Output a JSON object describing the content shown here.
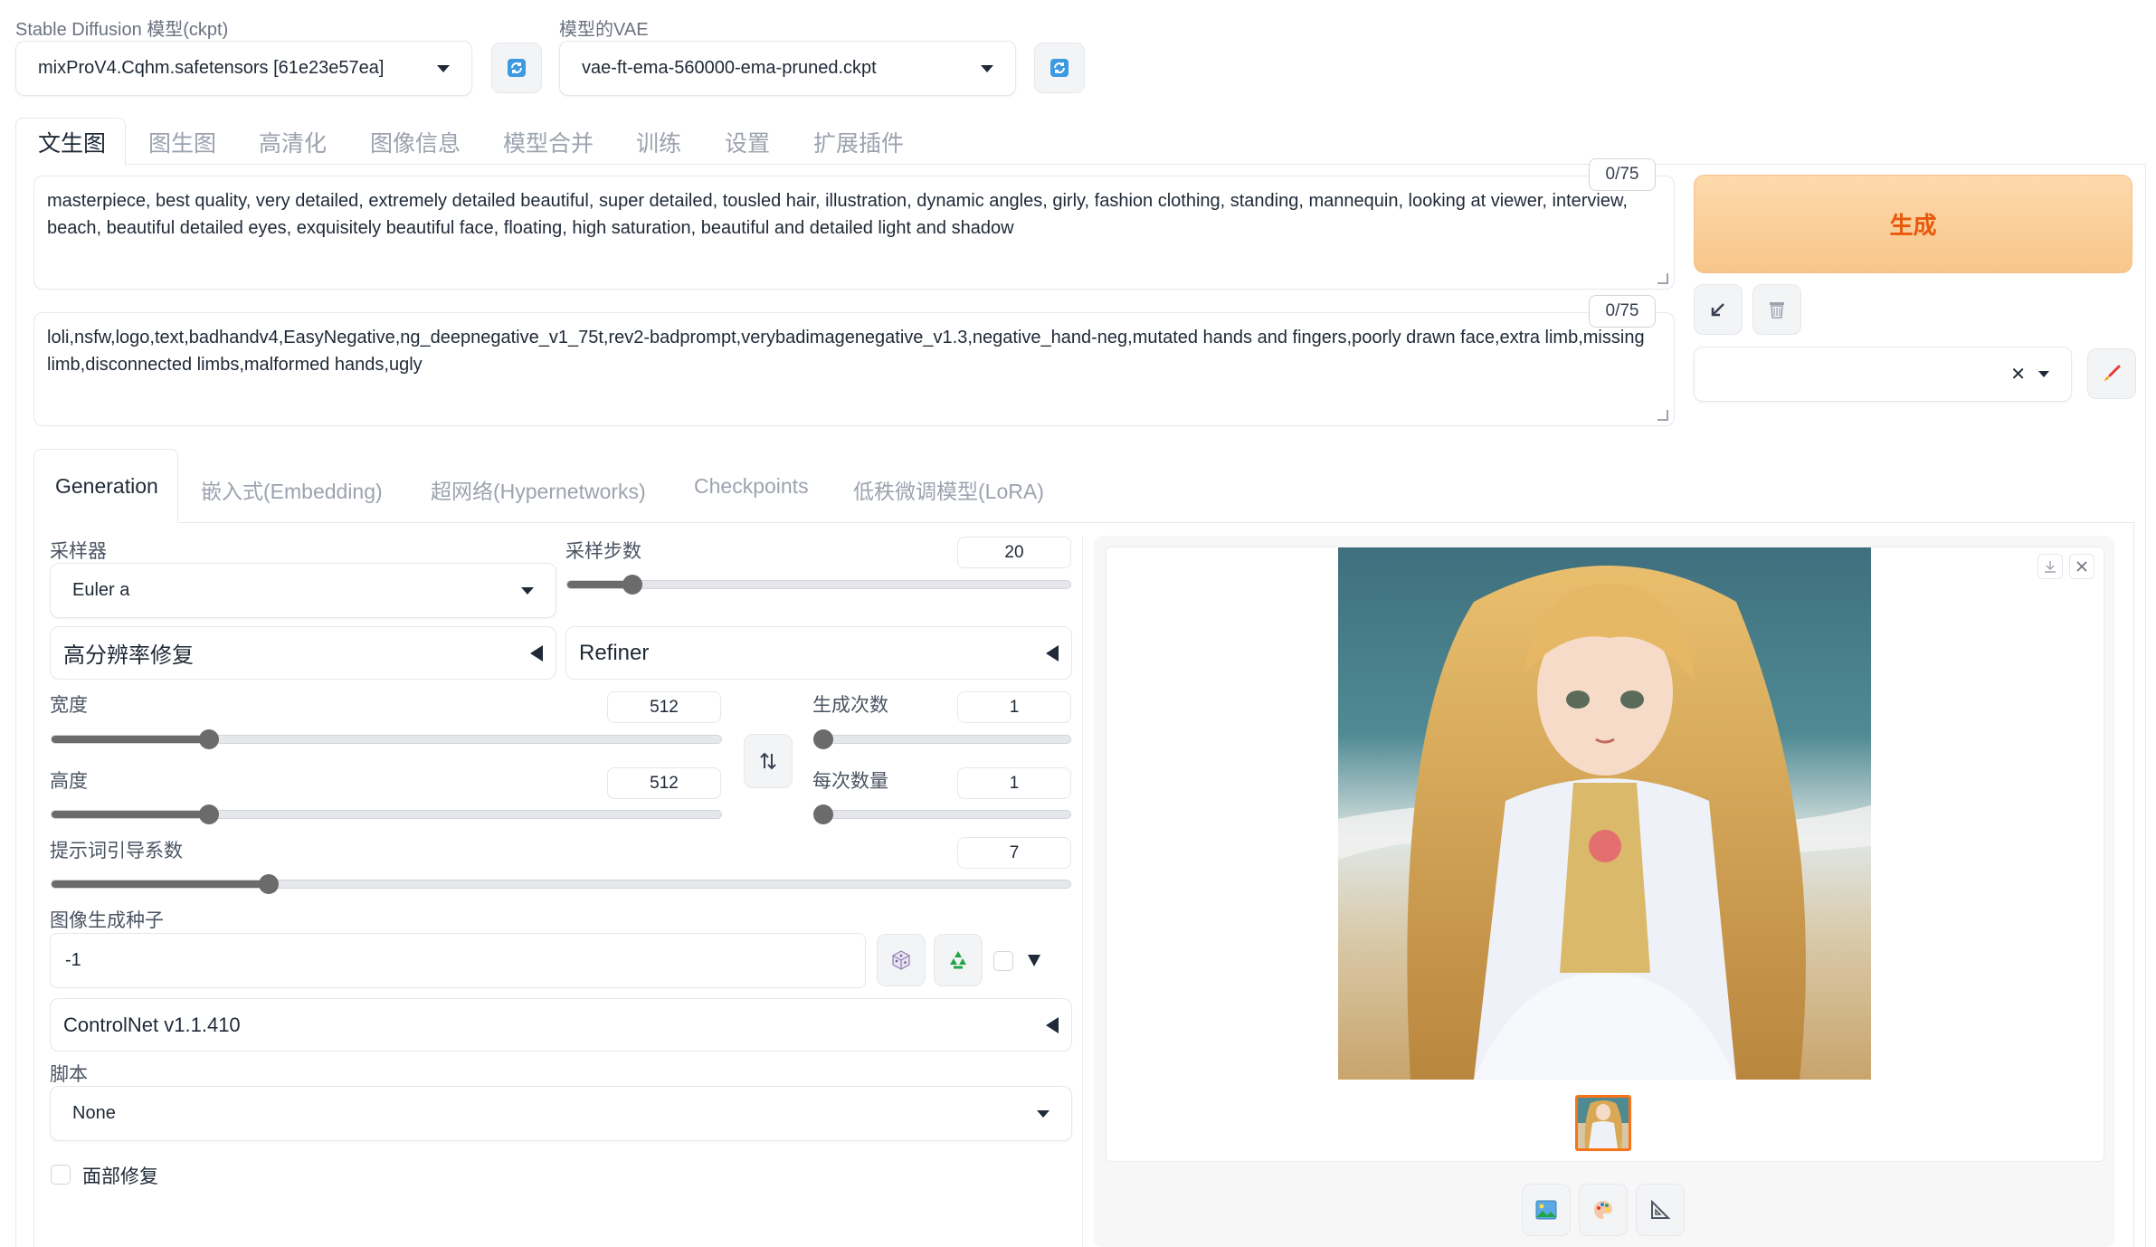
{
  "checkpoint": {
    "label": "Stable Diffusion 模型(ckpt)",
    "value": "mixProV4.Cqhm.safetensors [61e23e57ea]"
  },
  "vae": {
    "label": "模型的VAE",
    "value": "vae-ft-ema-560000-ema-pruned.ckpt"
  },
  "main_tabs": [
    "文生图",
    "图生图",
    "高清化",
    "图像信息",
    "模型合并",
    "训练",
    "设置",
    "扩展插件"
  ],
  "prompt": {
    "text": "masterpiece, best quality, very detailed, extremely detailed beautiful, super detailed, tousled hair, illustration, dynamic angles, girly, fashion clothing, standing, mannequin, looking at viewer, interview, beach, beautiful detailed eyes, exquisitely beautiful face, floating, high saturation, beautiful and detailed light and shadow",
    "counter": "0/75"
  },
  "negative_prompt": {
    "text": "loli,nsfw,logo,text,badhandv4,EasyNegative,ng_deepnegative_v1_75t,rev2-badprompt,verybadimagenegative_v1.3,negative_hand-neg,mutated hands and fingers,poorly drawn face,extra limb,missing limb,disconnected limbs,malformed hands,ugly",
    "counter": "0/75"
  },
  "generate_button": "生成",
  "colors": {
    "generate_bg_top": "#fdd7a6",
    "generate_bg_bottom": "#f9c98e",
    "generate_text": "#ea580c",
    "accent_blue": "#3b9ae1"
  },
  "sub_tabs": [
    "Generation",
    "嵌入式(Embedding)",
    "超网络(Hypernetworks)",
    "Checkpoints",
    "低秩微调模型(LoRA)"
  ],
  "sampler": {
    "label": "采样器",
    "value": "Euler a"
  },
  "steps": {
    "label": "采样步数",
    "value": "20",
    "fraction": 0.13
  },
  "hires": {
    "label": "高分辨率修复"
  },
  "refiner": {
    "label": "Refiner"
  },
  "width": {
    "label": "宽度",
    "value": "512",
    "fraction": 0.235
  },
  "height": {
    "label": "高度",
    "value": "512",
    "fraction": 0.235
  },
  "batch_count": {
    "label": "生成次数",
    "value": "1",
    "fraction": 0.0
  },
  "batch_size": {
    "label": "每次数量",
    "value": "1",
    "fraction": 0.0
  },
  "cfg": {
    "label": "提示词引导系数",
    "value": "7",
    "fraction": 0.213
  },
  "seed": {
    "label": "图像生成种子",
    "value": "-1"
  },
  "controlnet": {
    "label": "ControlNet v1.1.410"
  },
  "script": {
    "label": "脚本",
    "value": "None"
  },
  "face_restore": {
    "label": "面部修复"
  }
}
